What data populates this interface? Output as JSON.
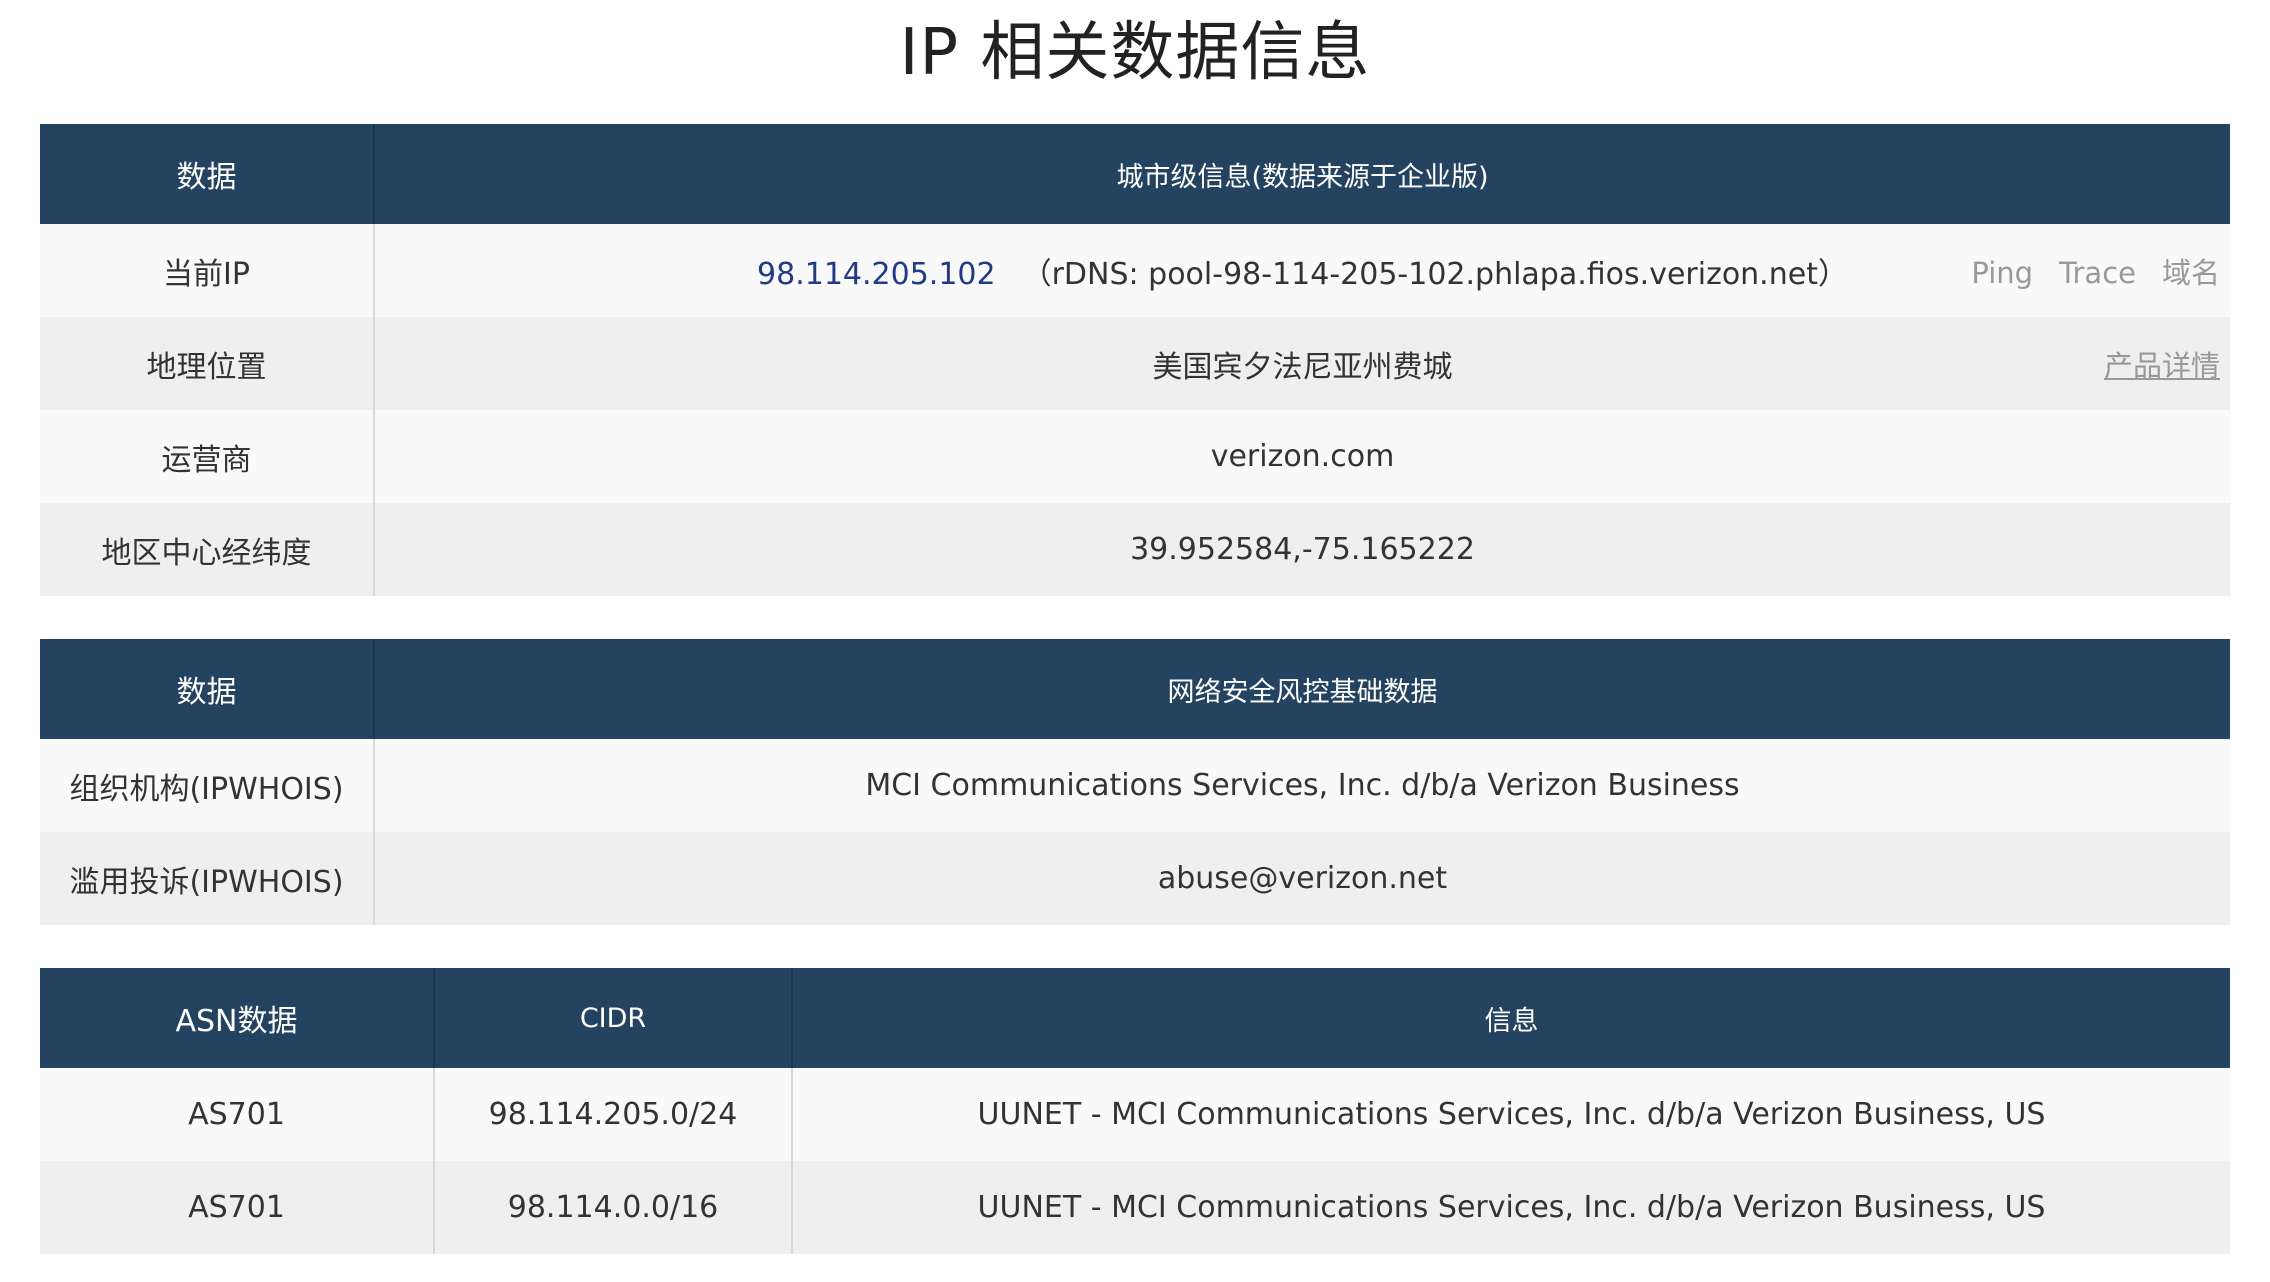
{
  "title": "IP 相关数据信息",
  "city_table": {
    "headers": [
      "数据",
      "城市级信息(数据来源于企业版)"
    ],
    "current_ip": {
      "label": "当前IP",
      "ip": "98.114.205.102",
      "rdns": "（rDNS: pool-98-114-205-102.phlapa.fios.verizon.net）",
      "links": [
        "Ping",
        "Trace",
        "域名"
      ]
    },
    "location": {
      "label": "地理位置",
      "value": "美国宾夕法尼亚州费城",
      "link": "产品详情"
    },
    "isp": {
      "label": "运营商",
      "value": "verizon.com"
    },
    "coords": {
      "label": "地区中心经纬度",
      "value": "39.952584,-75.165222"
    }
  },
  "security_table": {
    "headers": [
      "数据",
      "网络安全风控基础数据"
    ],
    "rows": [
      {
        "label": "组织机构(IPWHOIS)",
        "value": "MCI Communications Services, Inc. d/b/a Verizon Business"
      },
      {
        "label": "滥用投诉(IPWHOIS)",
        "value": "abuse@verizon.net"
      }
    ]
  },
  "asn_table": {
    "headers": [
      "ASN数据",
      "CIDR",
      "信息"
    ],
    "rows": [
      {
        "asn": "AS701",
        "cidr": "98.114.205.0/24",
        "info": "UUNET - MCI Communications Services, Inc. d/b/a Verizon Business, US"
      },
      {
        "asn": "AS701",
        "cidr": "98.114.0.0/16",
        "info": "UUNET - MCI Communications Services, Inc. d/b/a Verizon Business, US"
      }
    ]
  },
  "colors": {
    "header_bg": "#244361",
    "header_text": "#ffffff",
    "row_light": "#f9f9f9",
    "row_dark": "#efefef",
    "ip_link": "#1f3a8a",
    "muted_link": "#999999"
  }
}
